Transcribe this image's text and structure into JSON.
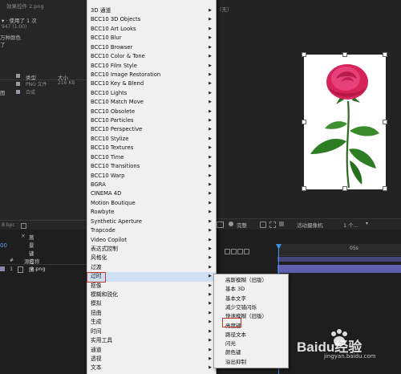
{
  "project": {
    "header_file": "效果控件 2.png",
    "line1": "▾ · 使用了 1 次",
    "line2": "947 (1.00)",
    "line3": "万种颜色",
    "line4": "了",
    "col_type": "类型",
    "col_size": "大小",
    "row1_name": "PNG 文件",
    "row1_size": "216 KB",
    "row2_prefix": "图",
    "row2_type": "合成",
    "bpc": "8 bpc"
  },
  "viewer": {
    "top_label": "（无）",
    "zoom_label": "完整",
    "camera_label": "活动摄像机",
    "views_label": "1 个..."
  },
  "timeline": {
    "comp_tab": "蒿景键控图",
    "col_source": "源名称",
    "layer_index": "1",
    "layer_name": "2.png",
    "time_marker": "05s"
  },
  "menu_items": [
    {
      "label": "3D 通道",
      "submenu": true
    },
    {
      "label": "BCC10 3D Objects",
      "submenu": true
    },
    {
      "label": "BCC10 Art Looks",
      "submenu": true
    },
    {
      "label": "BCC10 Blur",
      "submenu": true
    },
    {
      "label": "BCC10 Browser",
      "submenu": true
    },
    {
      "label": "BCC10 Color & Tone",
      "submenu": true
    },
    {
      "label": "BCC10 Film Style",
      "submenu": true
    },
    {
      "label": "BCC10 Image Restoration",
      "submenu": true
    },
    {
      "label": "BCC10 Key & Blend",
      "submenu": true
    },
    {
      "label": "BCC10 Lights",
      "submenu": true
    },
    {
      "label": "BCC10 Match Move",
      "submenu": true
    },
    {
      "label": "BCC10 Obsolete",
      "submenu": true
    },
    {
      "label": "BCC10 Particles",
      "submenu": true
    },
    {
      "label": "BCC10 Perspective",
      "submenu": true
    },
    {
      "label": "BCC10 Stylize",
      "submenu": true
    },
    {
      "label": "BCC10 Textures",
      "submenu": true
    },
    {
      "label": "BCC10 Time",
      "submenu": true
    },
    {
      "label": "BCC10 Transitions",
      "submenu": true
    },
    {
      "label": "BCC10 Warp",
      "submenu": true
    },
    {
      "label": "BGRA",
      "submenu": true
    },
    {
      "label": "CINEMA 4D",
      "submenu": true
    },
    {
      "label": "Motion Boutique",
      "submenu": true
    },
    {
      "label": "Rowbyte",
      "submenu": true
    },
    {
      "label": "Synthetic Aperture",
      "submenu": true
    },
    {
      "label": "Trapcode",
      "submenu": true
    },
    {
      "label": "Video Copilot",
      "submenu": true
    },
    {
      "label": "表达式控制",
      "submenu": true
    },
    {
      "label": "风格化",
      "submenu": true
    },
    {
      "label": "过渡",
      "submenu": true
    },
    {
      "label": "过时",
      "submenu": true
    },
    {
      "label": "抠像",
      "submenu": true
    },
    {
      "label": "模糊和锐化",
      "submenu": true
    },
    {
      "label": "模拟",
      "submenu": true
    },
    {
      "label": "扭曲",
      "submenu": true
    },
    {
      "label": "生成",
      "submenu": true
    },
    {
      "label": "时间",
      "submenu": true
    },
    {
      "label": "实用工具",
      "submenu": true
    },
    {
      "label": "通道",
      "submenu": true
    },
    {
      "label": "透视",
      "submenu": true
    },
    {
      "label": "文本",
      "submenu": true
    }
  ],
  "submenu_items": [
    {
      "label": "高斯模糊（旧版）"
    },
    {
      "label": "基本 3D"
    },
    {
      "label": "基本文字"
    },
    {
      "label": "减少交错闪烁"
    },
    {
      "label": "快速模糊（旧版）"
    },
    {
      "label": "亮度键"
    },
    {
      "label": "路径文本"
    },
    {
      "label": "闪光"
    },
    {
      "label": "颜色键"
    },
    {
      "label": "溢出抑制"
    }
  ],
  "watermark": {
    "brand": "Baidu经验",
    "url": "jingyan.baidu.com"
  },
  "colors": {
    "highlight_box": "#c0392b",
    "menu_bg": "#f0f0f0",
    "track": "#5f5fae",
    "playhead": "#3d8ee8"
  }
}
